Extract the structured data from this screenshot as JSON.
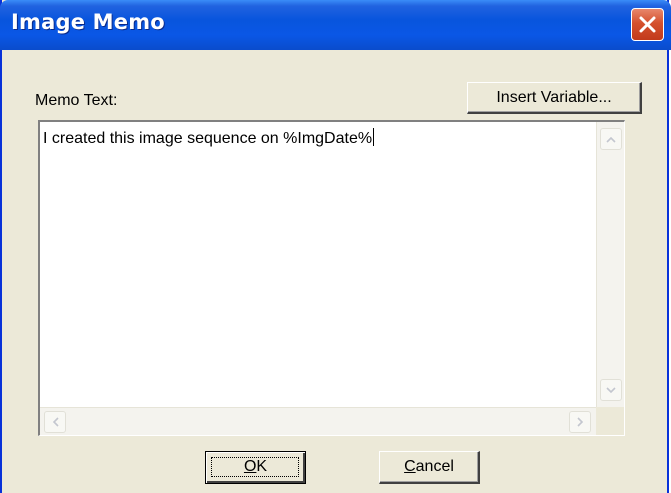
{
  "window": {
    "title": "Image Memo",
    "close_icon": "close-x-icon"
  },
  "memo": {
    "label": "Memo Text:",
    "insert_variable_label": "Insert Variable...",
    "text": "I created this image sequence on %ImgDate%"
  },
  "buttons": {
    "ok_label_mnemonic": "O",
    "ok_label_rest": "K",
    "cancel_label_mnemonic": "C",
    "cancel_label_rest": "ancel"
  },
  "colors": {
    "titlebar": "#0a57e6",
    "close_button": "#d5512e",
    "dialog_face": "#ece9d8"
  }
}
